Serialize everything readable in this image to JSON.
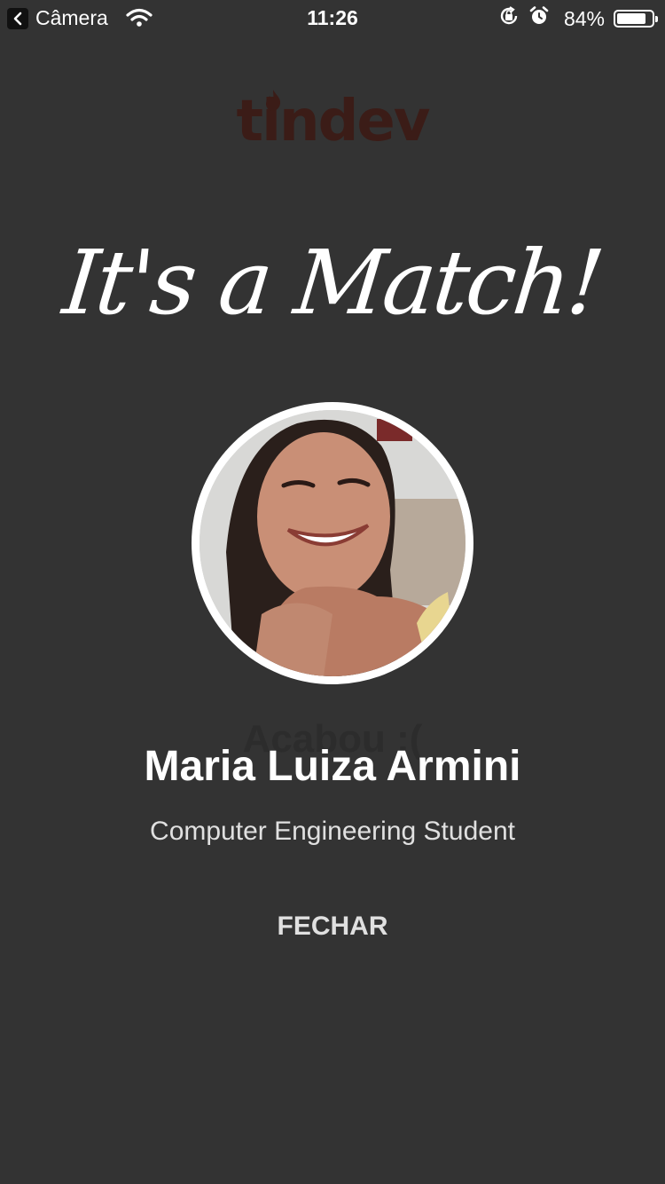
{
  "status_bar": {
    "back_app_label": "Câmera",
    "time": "11:26",
    "battery_percent": "84%",
    "battery_level": 0.84,
    "icons": [
      "back-chevron-icon",
      "wifi-icon",
      "orientation-lock-icon",
      "alarm-icon",
      "battery-icon"
    ]
  },
  "logo": {
    "text": "tindev",
    "color": "#3b1c17"
  },
  "match": {
    "title": "It's a Match!",
    "name": "Maria Luiza Armini",
    "bio": "Computer Engineering Student",
    "close_label": "FECHAR"
  },
  "background": {
    "empty_message": "Acabou :(",
    "color": "#333333"
  }
}
